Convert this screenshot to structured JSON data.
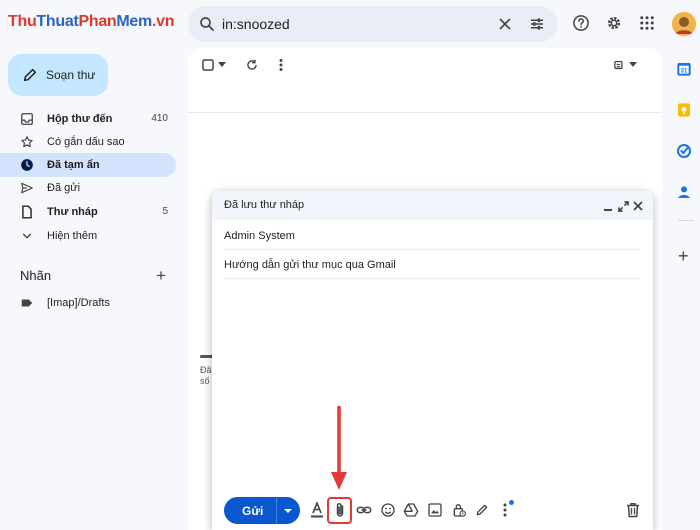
{
  "header": {
    "logo_part1": "Thu",
    "logo_part2": "Thuat",
    "logo_part3": "Phan",
    "logo_part4": "Mem",
    "logo_part5": ".vn",
    "search_value": "in:snoozed"
  },
  "sidebar": {
    "compose_label": "Soạn thư",
    "items": [
      {
        "label": "Hộp thư đến",
        "count": "410",
        "icon": "inbox-icon"
      },
      {
        "label": "Có gắn dấu sao",
        "icon": "star-icon"
      },
      {
        "label": "Đã tạm ẩn",
        "icon": "clock-icon"
      },
      {
        "label": "Đã gửi",
        "icon": "send-icon"
      },
      {
        "label": "Thư nháp",
        "count": "5",
        "icon": "draft-icon"
      },
      {
        "label": "Hiện thêm",
        "icon": "chevron-down-icon"
      }
    ],
    "labels_title": "Nhãn",
    "labels": [
      {
        "label": "[Imap]/Drafts",
        "icon": "label-icon"
      }
    ]
  },
  "main": {
    "peek_line1": "Đã",
    "peek_line2": "số"
  },
  "compose": {
    "title": "Đã lưu thư nháp",
    "to": "Admin System",
    "subject": "Hướng dẫn gửi thư mục qua Gmail",
    "send_label": "Gửi"
  },
  "colors": {
    "accent": "#0b57d0",
    "compose_button": "#c2e7ff",
    "active_nav": "#d3e3fd",
    "highlight": "#e53935"
  }
}
